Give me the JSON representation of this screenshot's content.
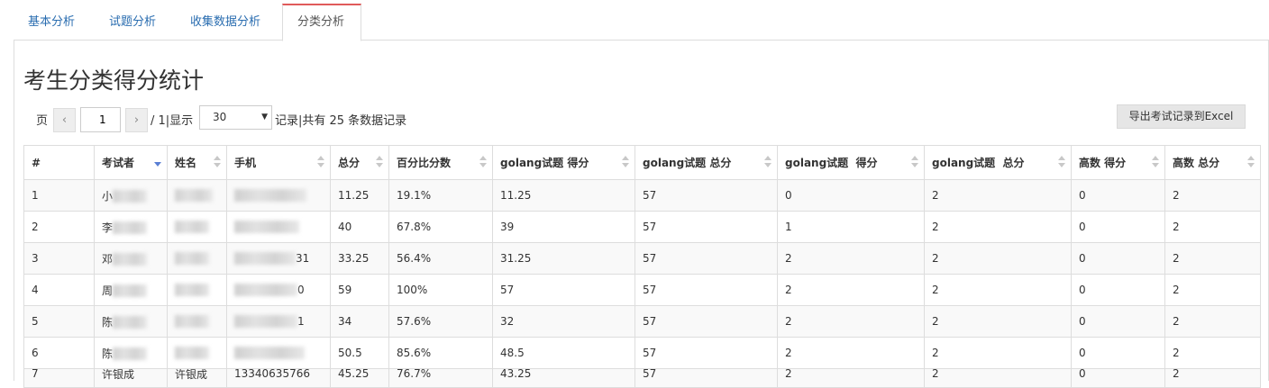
{
  "tabs": [
    {
      "label": "基本分析",
      "active": false
    },
    {
      "label": "试题分析",
      "active": false
    },
    {
      "label": "收集数据分析",
      "active": false
    },
    {
      "label": "分类分析",
      "active": true
    }
  ],
  "page_title": "考生分类得分统计",
  "pager": {
    "page_label": "页",
    "prev_icon": "‹",
    "next_icon": "›",
    "current_page": "1",
    "total_pages_text": "/ 1|显示",
    "page_size": "30",
    "records_text": "记录|共有 25 条数据记录"
  },
  "export_button": "导出考试记录到Excel",
  "table": {
    "headers": [
      "#",
      "考试者",
      "姓名",
      "手机",
      "总分",
      "百分比分数",
      "golang试题 得分",
      "golang试题 总分",
      "golang试题  得分",
      "golang试题  总分",
      "高数 得分",
      "高数 总分"
    ],
    "rows": [
      {
        "num": "1",
        "examinee": "小",
        "name": "",
        "phone": "",
        "total": "11.25",
        "pct": "19.1%",
        "g1_score": "11.25",
        "g1_total": "57",
        "g2_score": "0",
        "g2_total": "2",
        "m_score": "0",
        "m_total": "2"
      },
      {
        "num": "2",
        "examinee": "李",
        "name": "",
        "phone": "",
        "total": "40",
        "pct": "67.8%",
        "g1_score": "39",
        "g1_total": "57",
        "g2_score": "1",
        "g2_total": "2",
        "m_score": "0",
        "m_total": "2"
      },
      {
        "num": "3",
        "examinee": "邓",
        "name": "",
        "phone": "31",
        "total": "33.25",
        "pct": "56.4%",
        "g1_score": "31.25",
        "g1_total": "57",
        "g2_score": "2",
        "g2_total": "2",
        "m_score": "0",
        "m_total": "2"
      },
      {
        "num": "4",
        "examinee": "周",
        "name": "",
        "phone": "0",
        "total": "59",
        "pct": "100%",
        "g1_score": "57",
        "g1_total": "57",
        "g2_score": "2",
        "g2_total": "2",
        "m_score": "0",
        "m_total": "2"
      },
      {
        "num": "5",
        "examinee": "陈",
        "name": "",
        "phone": "1",
        "total": "34",
        "pct": "57.6%",
        "g1_score": "32",
        "g1_total": "57",
        "g2_score": "2",
        "g2_total": "2",
        "m_score": "0",
        "m_total": "2"
      },
      {
        "num": "6",
        "examinee": "陈",
        "name": "",
        "phone": "",
        "total": "50.5",
        "pct": "85.6%",
        "g1_score": "48.5",
        "g1_total": "57",
        "g2_score": "2",
        "g2_total": "2",
        "m_score": "0",
        "m_total": "2"
      },
      {
        "num": "7",
        "examinee": "许银成",
        "name": "许银成",
        "phone": "13340635766",
        "total": "45.25",
        "pct": "76.7%",
        "g1_score": "43.25",
        "g1_total": "57",
        "g2_score": "2",
        "g2_total": "2",
        "m_score": "0",
        "m_total": "2"
      }
    ]
  }
}
